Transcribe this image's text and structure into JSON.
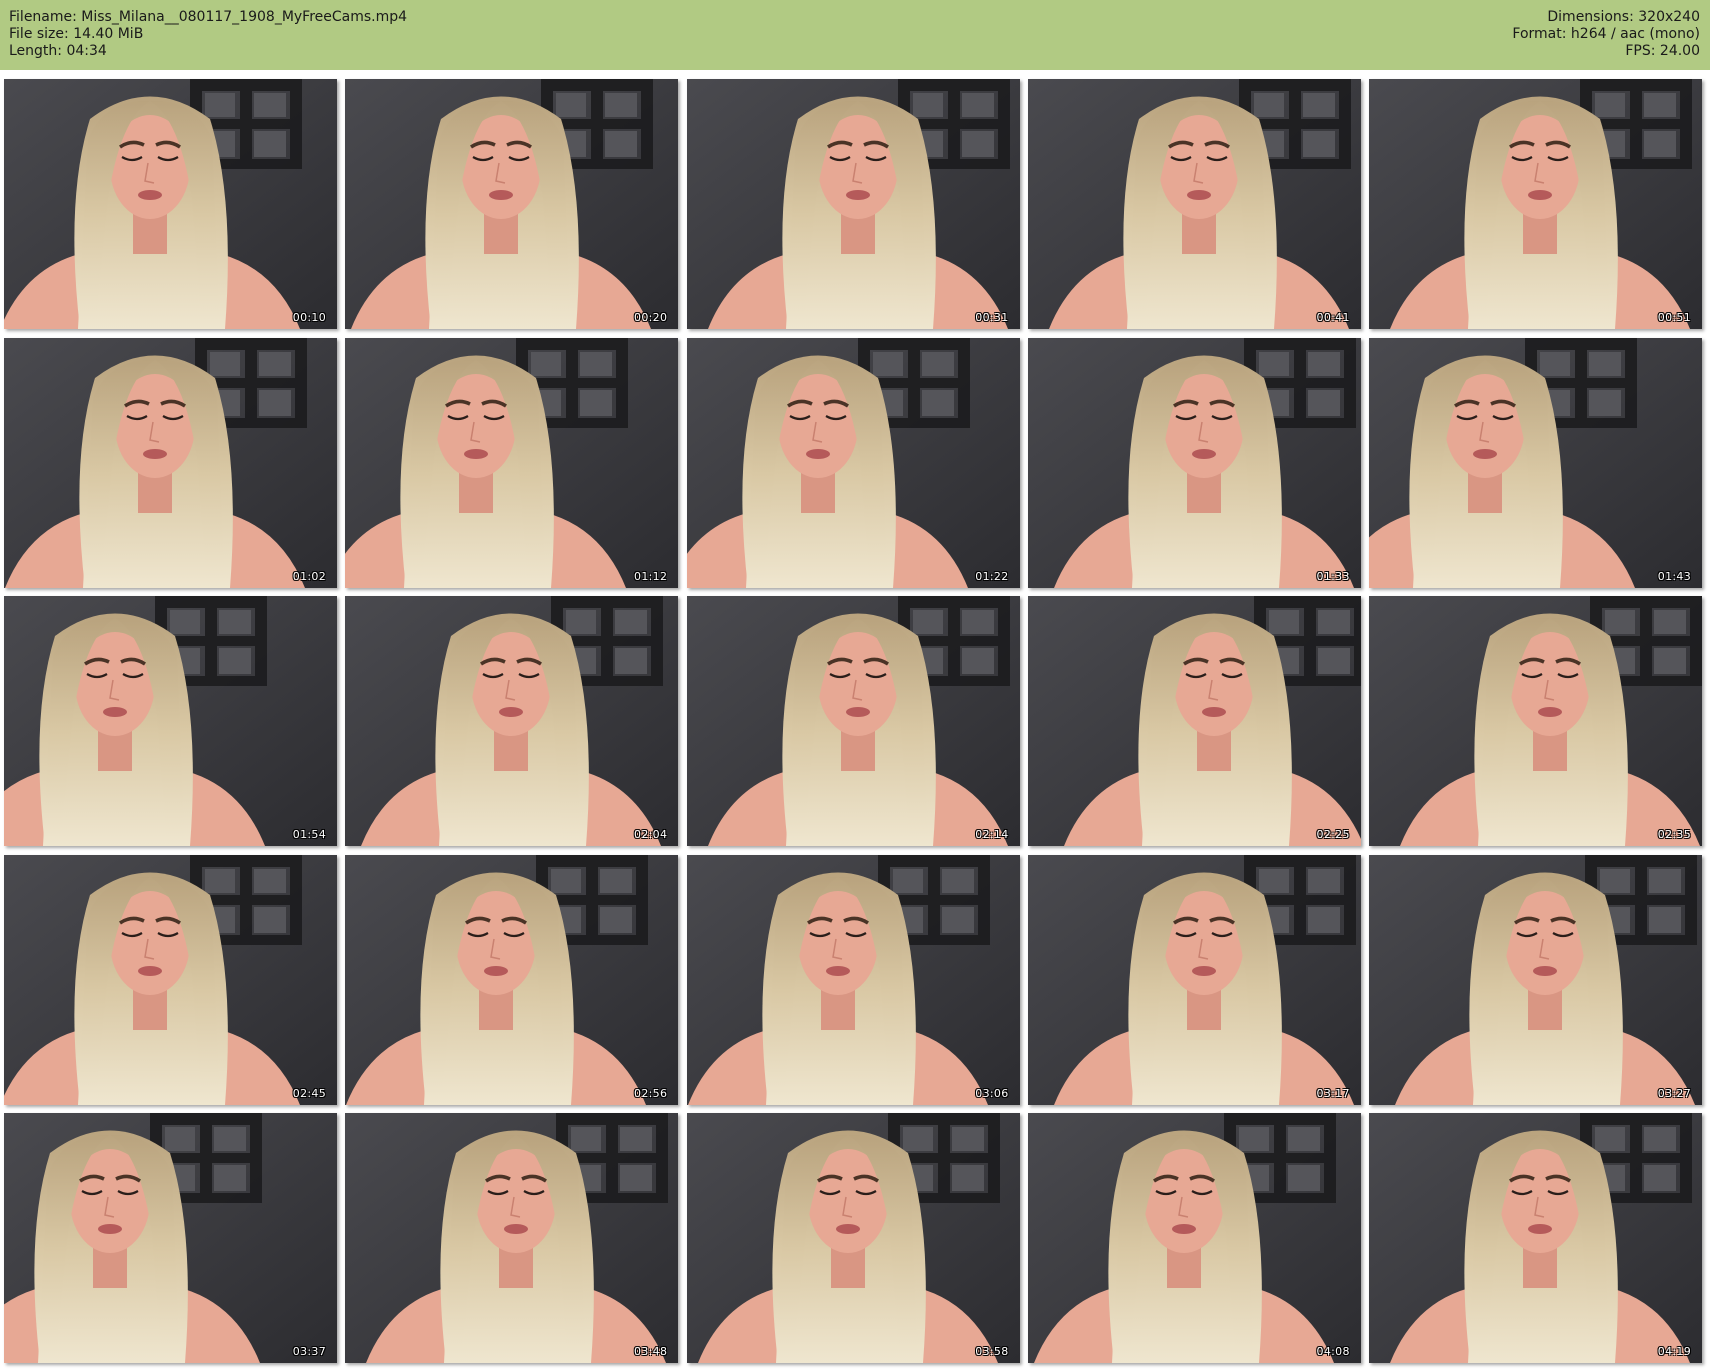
{
  "header": {
    "filename": "Filename: Miss_Milana__080117_1908_MyFreeCams.mp4",
    "filesize": "File size: 14.40 MiB",
    "length": "Length: 04:34",
    "dimensions": "Dimensions: 320x240",
    "format": "Format: h264 / aac (mono)",
    "fps": "FPS: 24.00"
  },
  "colors": {
    "header_bg": "#b1ca83",
    "wall": "#3a3a3e",
    "shelf": "#1c1c1e",
    "hair": "#d9c8a4",
    "skin": "#e7a894",
    "top": "#111111"
  },
  "thumbnails": [
    {
      "time": "00:10"
    },
    {
      "time": "00:20"
    },
    {
      "time": "00:31"
    },
    {
      "time": "00:41"
    },
    {
      "time": "00:51"
    },
    {
      "time": "01:02"
    },
    {
      "time": "01:12"
    },
    {
      "time": "01:22"
    },
    {
      "time": "01:33"
    },
    {
      "time": "01:43"
    },
    {
      "time": "01:54"
    },
    {
      "time": "02:04"
    },
    {
      "time": "02:14"
    },
    {
      "time": "02:25"
    },
    {
      "time": "02:35"
    },
    {
      "time": "02:45"
    },
    {
      "time": "02:56"
    },
    {
      "time": "03:06"
    },
    {
      "time": "03:17"
    },
    {
      "time": "03:27"
    },
    {
      "time": "03:37"
    },
    {
      "time": "03:48"
    },
    {
      "time": "03:58"
    },
    {
      "time": "04:08"
    },
    {
      "time": "04:19"
    }
  ]
}
